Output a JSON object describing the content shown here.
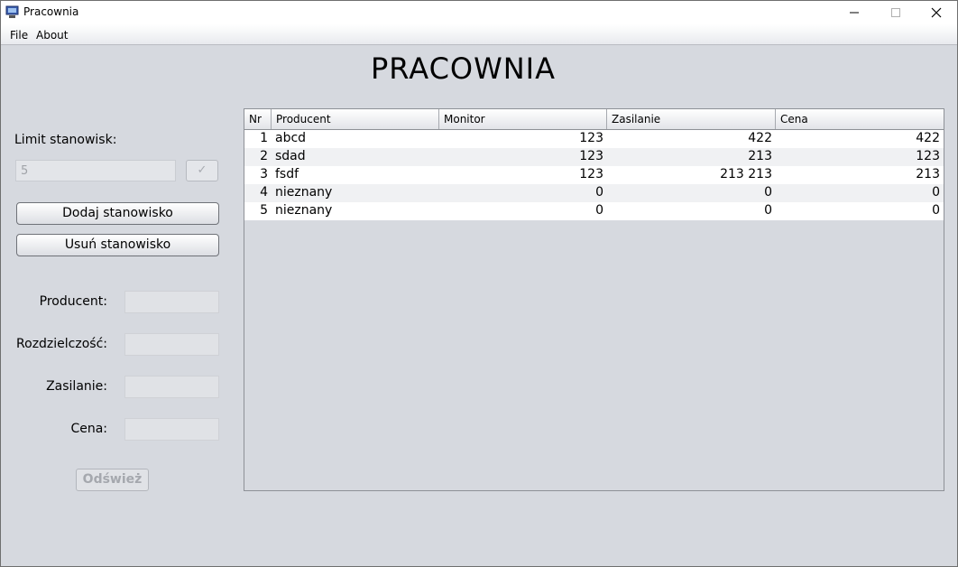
{
  "window": {
    "title": "Pracownia",
    "controls": {
      "minimize": "—",
      "maximize": "☐",
      "close": "✕"
    }
  },
  "menu": {
    "items": [
      "File",
      "About"
    ]
  },
  "heading": "PRACOWNIA",
  "sidebar": {
    "limit_label": "Limit stanowisk:",
    "limit_value": "5",
    "confirm_label": "✓",
    "add_button": "Dodaj stanowisko",
    "remove_button": "Usuń stanowisko",
    "fields": [
      {
        "label": "Producent:",
        "value": ""
      },
      {
        "label": "Rozdzielczość:",
        "value": ""
      },
      {
        "label": "Zasilanie:",
        "value": ""
      },
      {
        "label": "Cena:",
        "value": ""
      }
    ],
    "refresh_button": "Odśwież"
  },
  "table": {
    "columns": [
      "Nr",
      "Producent",
      "Monitor",
      "Zasilanie",
      "Cena"
    ],
    "rows": [
      [
        "1",
        "abcd",
        "123",
        "422",
        "422"
      ],
      [
        "2",
        "sdad",
        "123",
        "213",
        "123"
      ],
      [
        "3",
        "fsdf",
        "123",
        "213 213",
        "213"
      ],
      [
        "4",
        "nieznany",
        "0",
        "0",
        "0"
      ],
      [
        "5",
        "nieznany",
        "0",
        "0",
        "0"
      ]
    ]
  },
  "colors": {
    "background": "#d6d9df",
    "row_alt": "#f0f1f3",
    "row": "#ffffff"
  }
}
